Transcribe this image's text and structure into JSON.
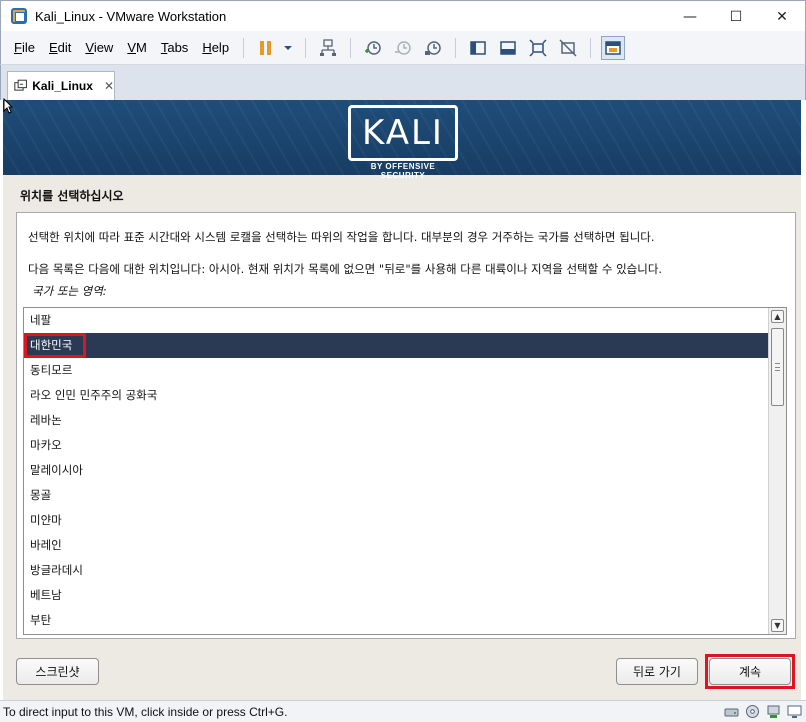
{
  "window": {
    "title": "Kali_Linux - VMware Workstation",
    "minimize": "—",
    "maximize": "☐",
    "close": "✕"
  },
  "menu": {
    "items": [
      {
        "u": "F",
        "rest": "ile"
      },
      {
        "u": "E",
        "rest": "dit"
      },
      {
        "u": "V",
        "rest": "iew"
      },
      {
        "u": "V",
        "rest": "M"
      },
      {
        "u": "T",
        "rest": "abs"
      },
      {
        "u": "H",
        "rest": "elp"
      }
    ]
  },
  "tab": {
    "label": "Kali_Linux",
    "close": "✕"
  },
  "banner": {
    "logo": "KALI",
    "tagline": "BY OFFENSIVE SECURITY"
  },
  "installer": {
    "heading": "위치를 선택하십시오",
    "description_1": "선택한 위치에 따라 표준 시간대와 시스템 로캘을 선택하는 따위의 작업을 합니다. 대부분의 경우 거주하는 국가를 선택하면 됩니다.",
    "description_2": "다음 목록은 다음에 대한 위치입니다: 아시아. 현재 위치가 목록에 없으면 \"뒤로\"를 사용해 다른 대륙이나 지역을 선택할 수 있습니다.",
    "prompt": "국가 또는 영역:",
    "countries": [
      "네팔",
      "대한민국",
      "동티모르",
      "라오 인민 민주주의 공화국",
      "레바논",
      "마카오",
      "말레이시아",
      "몽골",
      "미얀마",
      "바레인",
      "방글라데시",
      "베트남",
      "부탄"
    ],
    "selected": "대한민국",
    "buttons": {
      "screenshot": "스크린샷",
      "back": "뒤로 가기",
      "continue": "계속"
    }
  },
  "status": {
    "text": "To direct input to this VM, click inside or press Ctrl+G."
  },
  "colors": {
    "banner": "#1f4d7a",
    "selection": "#2b3a54",
    "highlight_box": "#e0141e"
  }
}
